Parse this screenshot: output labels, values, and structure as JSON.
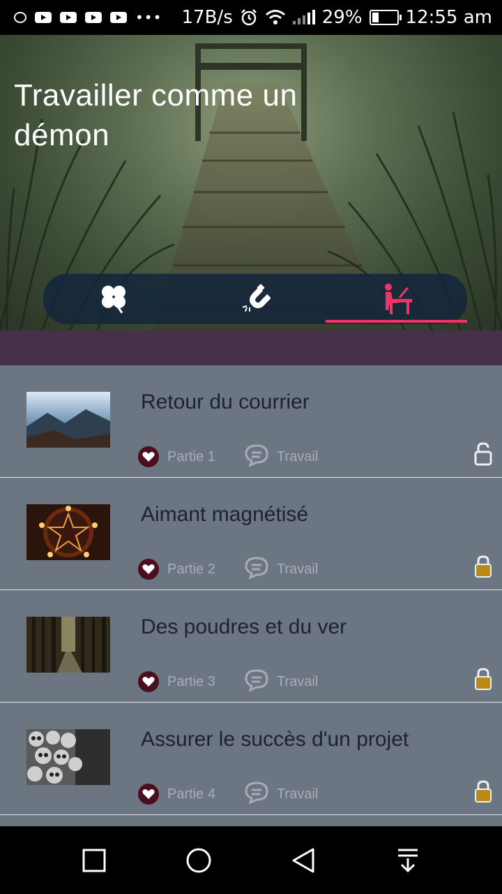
{
  "status": {
    "speed": "17B/s",
    "battery": "29%",
    "time": "12:55 am"
  },
  "header": {
    "title": "Travailler comme un démon"
  },
  "tabs": [
    {
      "icon": "clover-icon",
      "active": false
    },
    {
      "icon": "magnet-icon",
      "active": false
    },
    {
      "icon": "desk-worker-icon",
      "active": true
    }
  ],
  "items": [
    {
      "title": "Retour du courrier",
      "part": "Partie 1",
      "category": "Travail",
      "locked": false,
      "thumb": "mountain-image"
    },
    {
      "title": "Aimant magnétisé",
      "part": "Partie 2",
      "category": "Travail",
      "locked": true,
      "thumb": "pentagram-candles-image"
    },
    {
      "title": "Des poudres et du ver",
      "part": "Partie 3",
      "category": "Travail",
      "locked": true,
      "thumb": "forest-path-image"
    },
    {
      "title": "Assurer le succès d'un projet",
      "part": "Partie 4",
      "category": "Travail",
      "locked": true,
      "thumb": "skulls-image"
    }
  ],
  "colors": {
    "accent": "#f2336a",
    "band": "#46314a",
    "list_bg": "#6c7582",
    "title_text": "#1d2136",
    "lock_gold": "#b98a1a"
  }
}
